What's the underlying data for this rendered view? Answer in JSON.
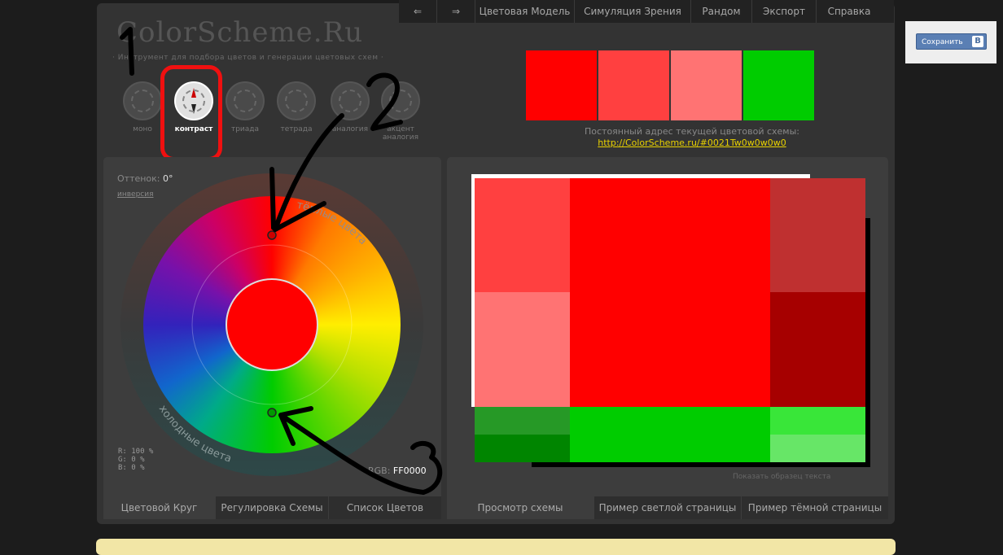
{
  "brand": {
    "logo": "ColorScheme.Ru",
    "tagline": "· Инструмент для подбора цветов и генерации цветовых схем ·"
  },
  "nav": {
    "back": "⇐",
    "forward": "⇒",
    "items": [
      "Цветовая Модель",
      "Симуляция Зрения",
      "Рандом",
      "Экспорт",
      "Справка"
    ]
  },
  "save": {
    "label": "Сохранить",
    "vk": "В"
  },
  "modes": [
    {
      "label": "моно"
    },
    {
      "label": "контраст"
    },
    {
      "label": "триада"
    },
    {
      "label": "тетрада"
    },
    {
      "label": "аналогия"
    },
    {
      "label": "акцент аналогия"
    }
  ],
  "swatches": [
    "#ff0000",
    "#ff4040",
    "#ff7373",
    "#00cc00"
  ],
  "permalink": {
    "text": "Постоянный адрес текущей цветовой схемы:",
    "url": "http://ColorScheme.ru/#0021Tw0w0w0w0"
  },
  "wheel": {
    "hue_label": "Оттенок:",
    "hue_value": "0°",
    "inverse": "инверсия",
    "warm": "тёплые цвета",
    "cold": "холодные цвета",
    "rgb_lines": [
      "R: 100 %",
      "G:    0 %",
      "B:    0 %"
    ],
    "rgb_label": "RGB:",
    "rgb_hex": "FF0000"
  },
  "left_tabs": [
    "Цветовой Круг",
    "Регулировка Схемы",
    "Список Цветов"
  ],
  "right_tabs": [
    "Просмотр схемы",
    "Пример светлой страницы",
    "Пример тёмной страницы"
  ],
  "preview": {
    "show_sample": "Показать образец текста",
    "colors": {
      "primary": "#ff0000",
      "p_light1": "#ff4040",
      "p_light2": "#ff7373",
      "p_dark1": "#bf3030",
      "p_dark2": "#a60000",
      "comp": "#00cc00",
      "c_dark1": "#269926",
      "c_dark2": "#008500",
      "c_light1": "#39e639",
      "c_light2": "#67e667"
    }
  },
  "annotations": [
    "1",
    "2",
    "3"
  ]
}
